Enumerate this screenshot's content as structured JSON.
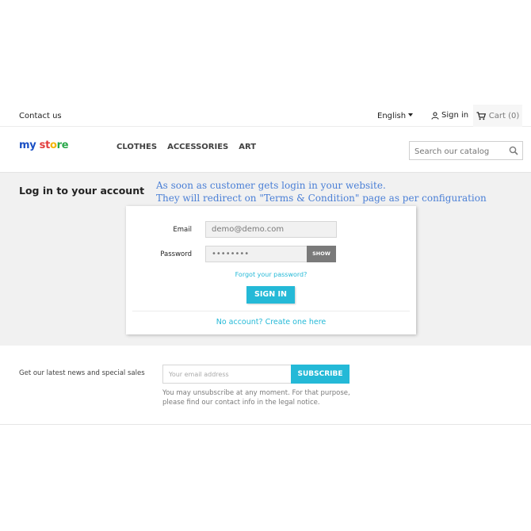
{
  "topbar": {
    "contact_label": "Contact us",
    "language": "English",
    "signin_label": "Sign in",
    "cart_label": "Cart (0)"
  },
  "header": {
    "logo_parts": [
      "my",
      " st",
      "o",
      "re"
    ],
    "logo_colors": [
      "#1a4fc4",
      "#e23b3b",
      "#f5b400",
      "#2aa84a"
    ],
    "nav": [
      "CLOTHES",
      "ACCESSORIES",
      "ART"
    ],
    "search_placeholder": "Search our catalog"
  },
  "main": {
    "title": "Log in to your account",
    "note_line1": "As soon as customer gets login in your website.",
    "note_line2": "They will redirect on \"Terms & Condition\" page as per configuration"
  },
  "login": {
    "email_label": "Email",
    "email_value": "demo@demo.com",
    "password_label": "Password",
    "password_value": "••••••••",
    "show_label": "SHOW",
    "forgot_label": "Forgot your password?",
    "signin_button": "SIGN IN",
    "no_account_label": "No account? Create one here"
  },
  "newsletter": {
    "label": "Get our latest news and special sales",
    "email_placeholder": "Your email address",
    "subscribe_label": "SUBSCRIBE",
    "legal_line1": "You may unsubscribe at any moment. For that purpose,",
    "legal_line2": "please find our contact info in the legal notice."
  },
  "colors": {
    "accent": "#24b9d7",
    "note_text": "#4a7fd6"
  },
  "icons": {
    "user": "user-icon",
    "cart": "cart-icon",
    "search": "search-icon",
    "caret": "caret-down-icon"
  }
}
